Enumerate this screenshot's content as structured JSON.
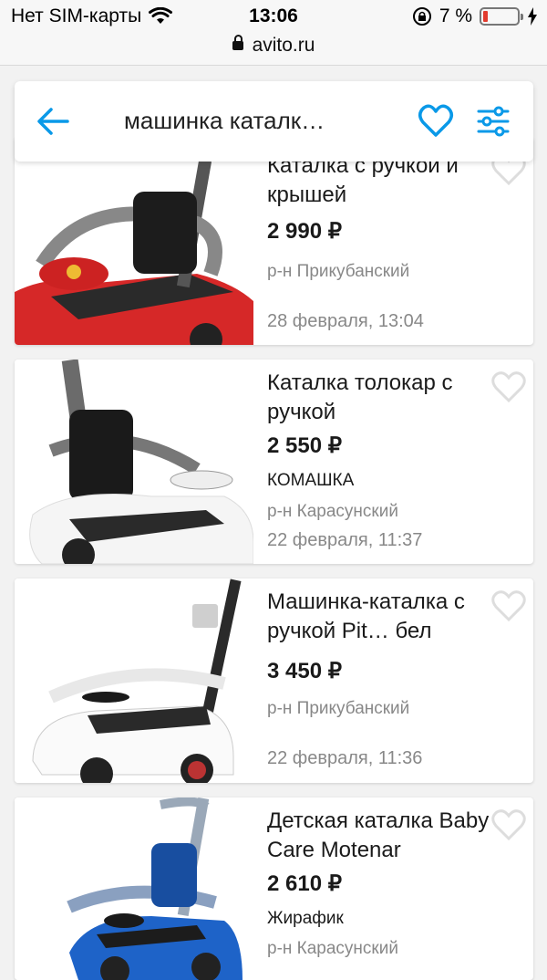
{
  "status": {
    "carrier": "Нет SIM-карты",
    "time": "13:06",
    "battery": "7 %",
    "url": "avito.ru"
  },
  "search": {
    "query": "машинка каталк…"
  },
  "listings": [
    {
      "title": "Каталка с ручкой и крышей",
      "price": "2 990 ₽",
      "shop": "",
      "area": "р-н Прикубанский",
      "date": "28 февраля, 13:04",
      "color": "#d62828"
    },
    {
      "title": "Каталка толокар с ручкой",
      "price": "2 550 ₽",
      "shop": "КОМАШКА",
      "area": "р-н Карасунский",
      "date": "22 февраля, 11:37",
      "color": "#f5f5f5"
    },
    {
      "title": "Машинка-каталка с ручкой Pit… бел",
      "price": "3 450 ₽",
      "shop": "",
      "area": "р-н Прикубанский",
      "date": "22 февраля, 11:36",
      "color": "#fafafa"
    },
    {
      "title": "Детская каталка Baby Care Motenar",
      "price": "2 610 ₽",
      "shop": "Жирафик",
      "area": "р-н Карасунский",
      "date": "",
      "color": "#1e63c8"
    }
  ],
  "accent": "#0a99e8"
}
